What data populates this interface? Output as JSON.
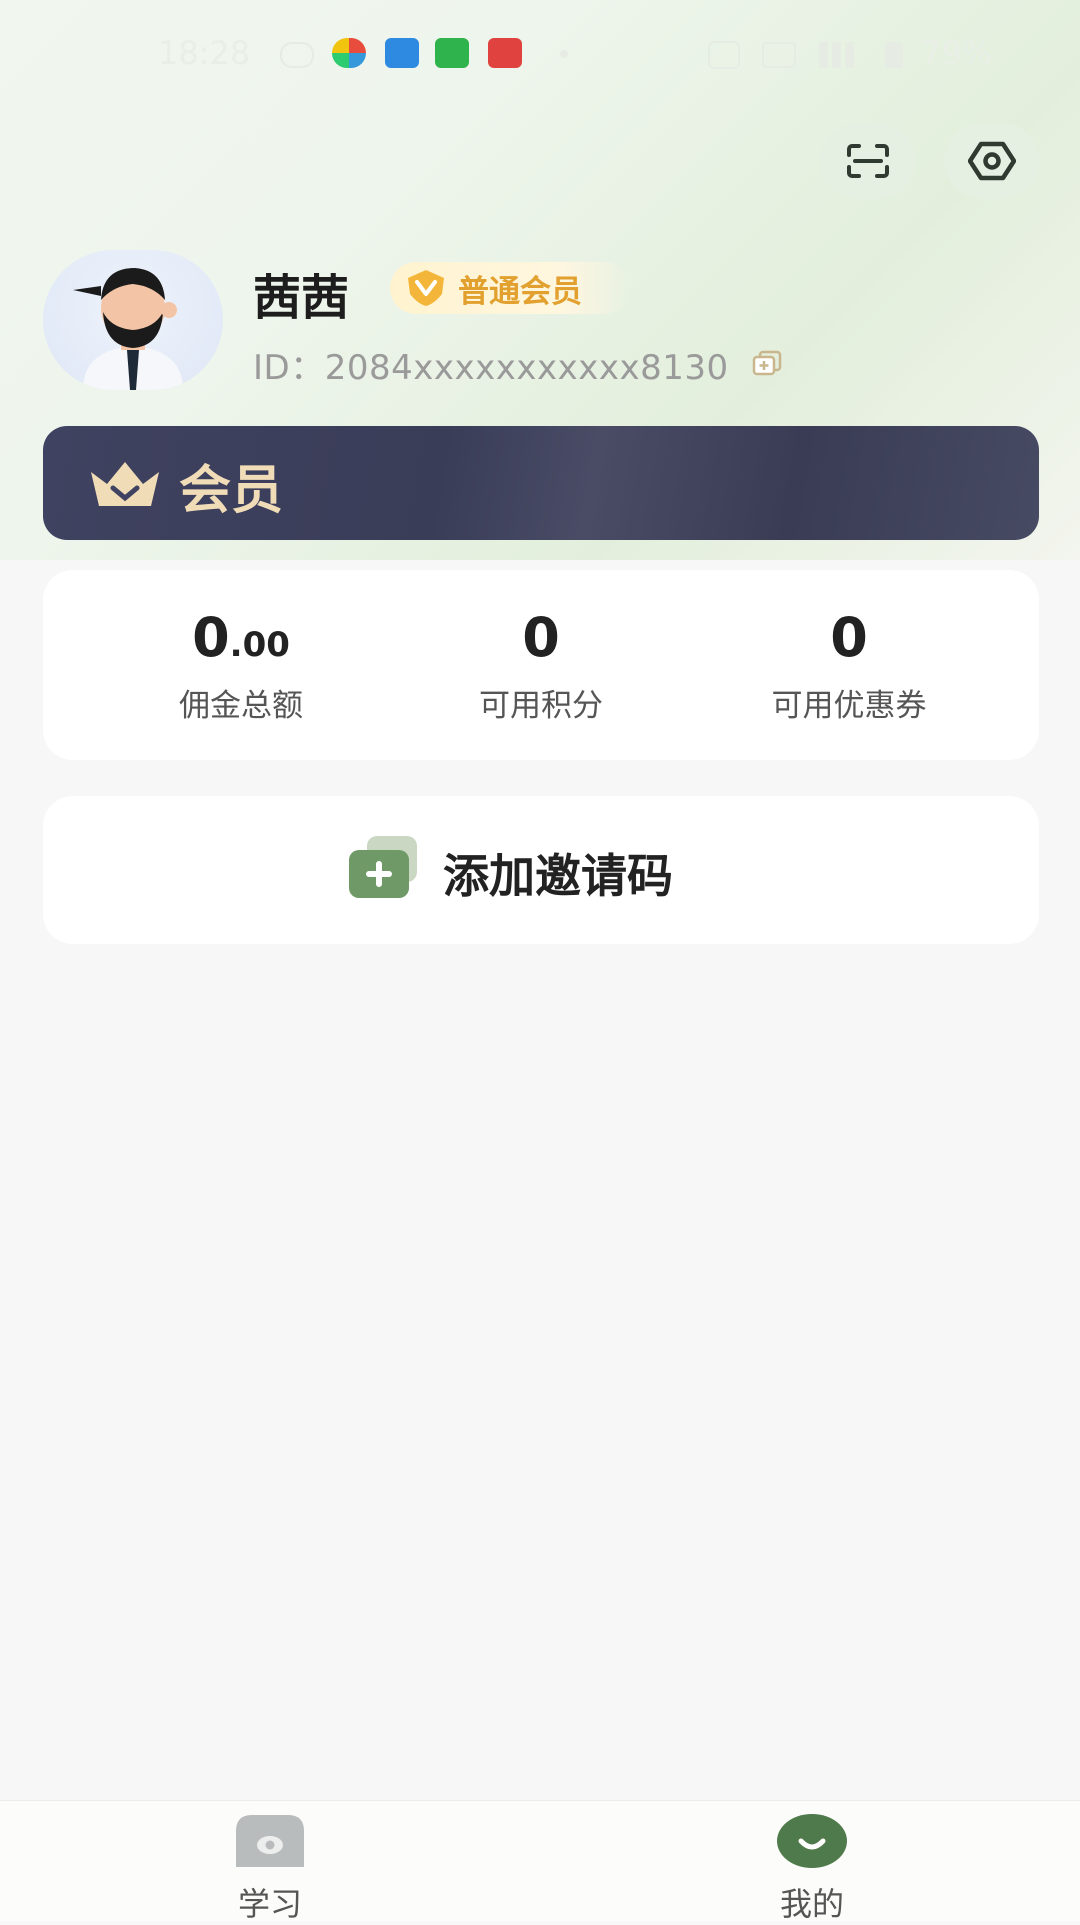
{
  "status_bar": {
    "time": "18:28",
    "battery": "79%"
  },
  "profile": {
    "name": "茜茜",
    "member_level": "普通会员",
    "id_label": "ID：",
    "id_value": "2084xxxxxxxxxxx8130"
  },
  "member_banner": {
    "label": "会员"
  },
  "stats": [
    {
      "value_int": "0",
      "value_dec": ".00",
      "label": "佣金总额"
    },
    {
      "value_int": "0",
      "value_dec": "",
      "label": "可用积分"
    },
    {
      "value_int": "0",
      "value_dec": "",
      "label": "可用优惠券"
    }
  ],
  "invite": {
    "label": "添加邀请码"
  },
  "nav": [
    {
      "label": "学习",
      "icon": "study-icon",
      "active": false
    },
    {
      "label": "我的",
      "icon": "mine-icon",
      "active": true
    }
  ],
  "colors": {
    "accent_green": "#4f7a4b",
    "badge_gold": "#e2a02e",
    "banner_dark": "#3f4260",
    "banner_text": "#f0dcb7"
  }
}
